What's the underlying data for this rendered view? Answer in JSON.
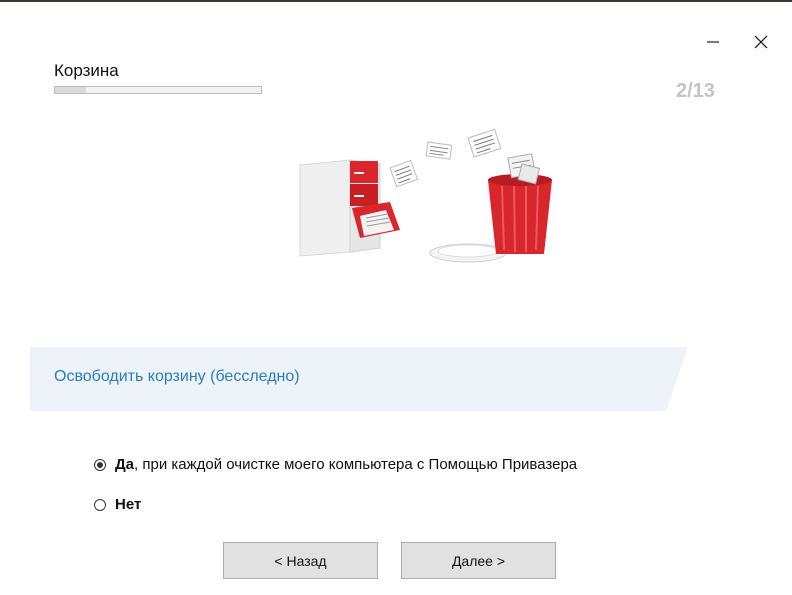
{
  "window": {
    "minimize_icon": "minimize-icon",
    "close_icon": "close-icon"
  },
  "header": {
    "title": "Корзина",
    "step_counter": "2/13",
    "progress_fraction": 0.15
  },
  "illustration": {
    "subject": "filing cabinet and recycle bin"
  },
  "banner": {
    "text": "Освободить корзину (бесследно)",
    "accent_color": "#2b7bbf",
    "background_color": "#eef3f9"
  },
  "options": [
    {
      "strong": "Да",
      "rest": ", при каждой очистке моего компьютера с Помощью Привазера",
      "selected": true
    },
    {
      "strong": "Нет",
      "rest": "",
      "selected": false
    }
  ],
  "buttons": {
    "back_label": "< Назад",
    "next_label": "Далее >"
  }
}
